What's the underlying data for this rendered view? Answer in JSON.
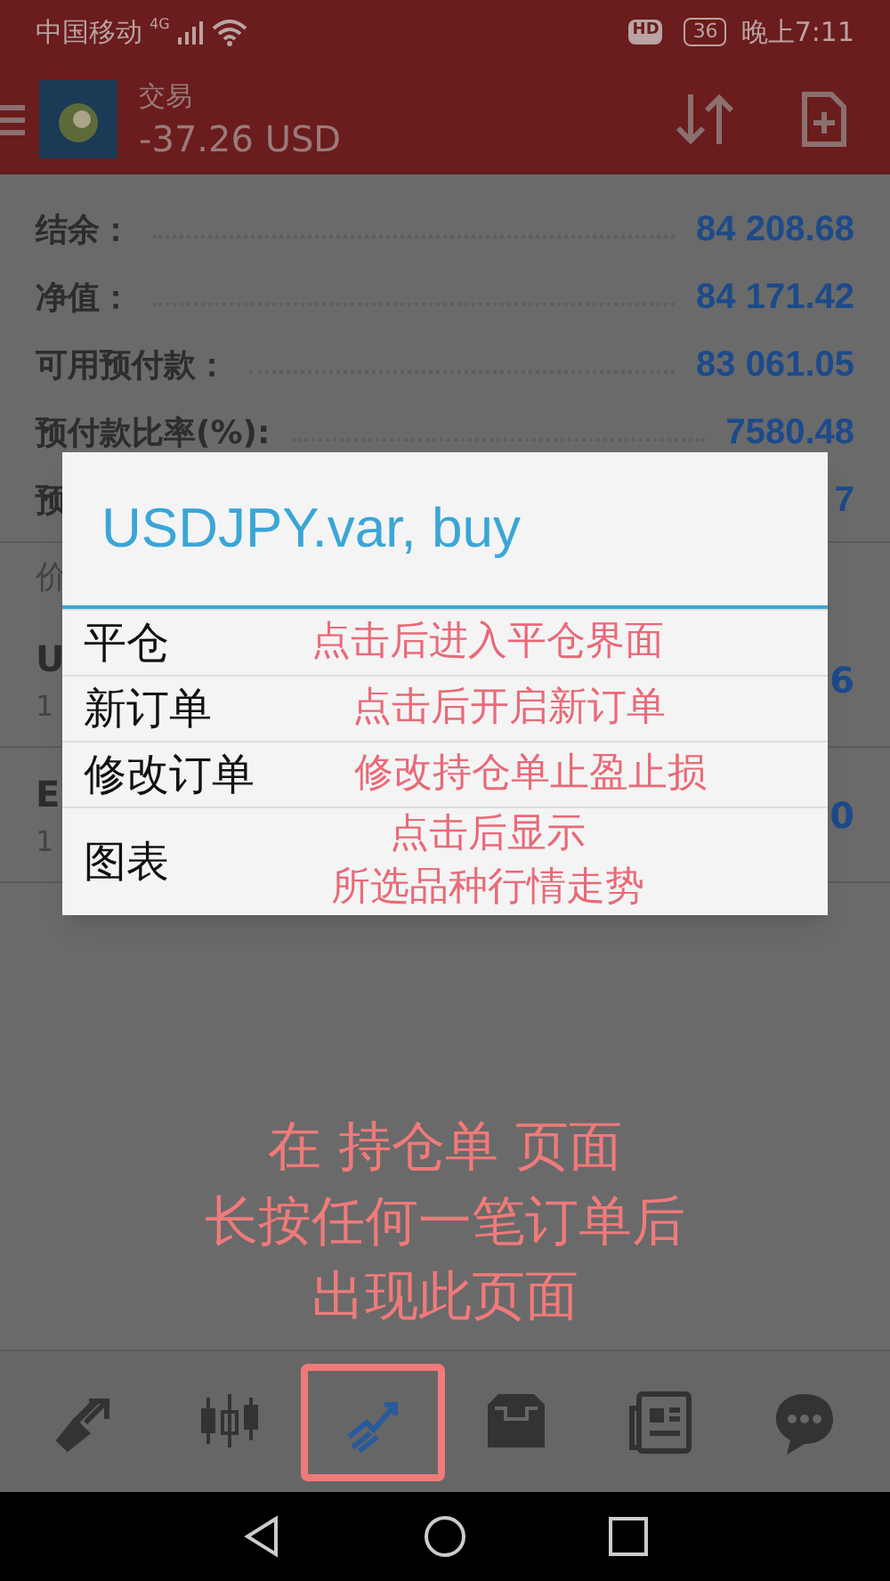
{
  "status_bar": {
    "carrier": "中国移动",
    "network": "4G",
    "hd": "HD",
    "battery": "36",
    "time": "晚上7:11"
  },
  "header": {
    "title": "交易",
    "balance": "-37.26 USD"
  },
  "account": [
    {
      "label": "结余：",
      "value": "84 208.68"
    },
    {
      "label": "净值：",
      "value": "84 171.42"
    },
    {
      "label": "可用预付款：",
      "value": "83 061.05"
    },
    {
      "label": "预付款比率(%):",
      "value": "7580.48"
    },
    {
      "label": "预",
      "value": "7"
    }
  ],
  "section_label": "价",
  "positions": [
    {
      "symbol": "U",
      "detail": "1",
      "profit": "6"
    },
    {
      "symbol": "E",
      "detail": "1",
      "profit": "0"
    }
  ],
  "dialog": {
    "title": "USDJPY.var, buy",
    "items": [
      {
        "label": "平仓",
        "note": [
          "点击后进入平仓界面"
        ]
      },
      {
        "label": "新订单",
        "note": [
          "点击后开启新订单"
        ]
      },
      {
        "label": "修改订单",
        "note": [
          "修改持仓单止盈止损"
        ]
      },
      {
        "label": "图表",
        "note": [
          "点击后显示",
          "所选品种行情走势"
        ]
      }
    ]
  },
  "annotation": [
    "在 持仓单 页面",
    "长按任何一笔订单后",
    "出现此页面"
  ],
  "nav": [
    {
      "kind": "trade",
      "selected": false
    },
    {
      "kind": "candles",
      "selected": false
    },
    {
      "kind": "trend",
      "selected": true
    },
    {
      "kind": "inbox",
      "selected": false
    },
    {
      "kind": "news",
      "selected": false
    },
    {
      "kind": "chat",
      "selected": false
    }
  ]
}
